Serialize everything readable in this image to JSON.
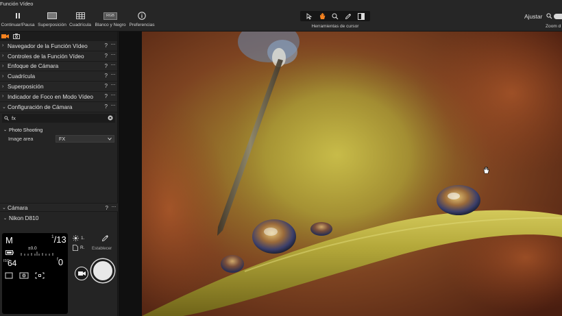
{
  "app": {
    "title": "Función Vídeo"
  },
  "toolbar": {
    "play_pause": "Continuar/Pausa",
    "overlay": "Superposición",
    "grid": "Cuadrícula",
    "bw_badge": "RGB",
    "bw": "Blanco y Negro",
    "preferences": "Preferencias",
    "cursor_tools": "Herramientas de cursor",
    "fit": "Ajustar",
    "zoom": "Zoom d"
  },
  "panels": [
    {
      "label": "Navegador de la Función Vídeo",
      "help": "?",
      "more": "···"
    },
    {
      "label": "Controles de la Función Vídeo",
      "help": "?",
      "more": "···"
    },
    {
      "label": "Enfoque de Cámara",
      "help": "?",
      "more": "···"
    },
    {
      "label": "Cuadrícula",
      "help": "?",
      "more": "···"
    },
    {
      "label": "Superposición",
      "help": "?",
      "more": "···"
    },
    {
      "label": "Indicador de Foco en Modo Vídeo",
      "help": "?",
      "more": "···"
    },
    {
      "label": "Configuración de Cámara",
      "help": "?",
      "more": "···"
    }
  ],
  "camera_settings": {
    "search_value": "fx",
    "group_label": "Photo Shooting",
    "image_area_label": "Image area",
    "image_area_value": "FX"
  },
  "camera": {
    "section_label": "Cámara",
    "help": "?",
    "more": "···",
    "model": "Nikon D810",
    "mode": "M",
    "shutter_num": "1",
    "shutter_den": "13",
    "ev": "±0.0",
    "iso_label": "ISO",
    "iso": "64",
    "aperture_prefix": "f",
    "aperture": "0",
    "wb_value": "1.",
    "file_value": "R.",
    "set_label": "Establecer"
  },
  "colors": {
    "accent": "#f5821f",
    "panel_bg": "#242424",
    "toolbar_bg": "#262626"
  }
}
